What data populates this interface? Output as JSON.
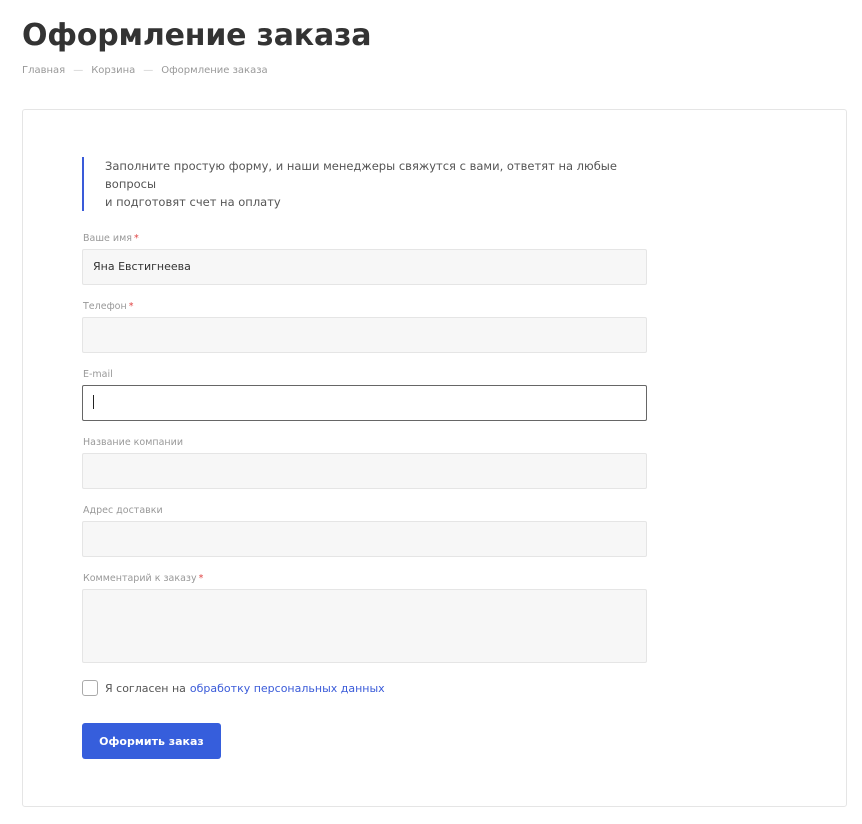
{
  "page": {
    "title": "Оформление заказа"
  },
  "breadcrumb": {
    "items": [
      "Главная",
      "Корзина",
      "Оформление заказа"
    ],
    "separator": "—"
  },
  "form": {
    "intro_line1": "Заполните простую форму, и наши менеджеры свяжутся с вами, ответят на любые вопросы",
    "intro_line2": "и подготовят счет на оплату",
    "required_mark": "*",
    "fields": [
      {
        "label": "Ваше имя",
        "required": true,
        "value": "Яна Евстигнеева"
      },
      {
        "label": "Телефон",
        "required": true,
        "value": ""
      },
      {
        "label": "E-mail",
        "required": false,
        "value": "",
        "focused": true
      },
      {
        "label": "Название компании",
        "required": false,
        "value": ""
      },
      {
        "label": "Адрес доставки",
        "required": false,
        "value": ""
      },
      {
        "label": "Комментарий к заказу",
        "required": true,
        "value": ""
      }
    ],
    "consent_text": "Я согласен на",
    "consent_link": "обработку персональных данных",
    "consent_checked": false,
    "submit_label": "Оформить заказ"
  },
  "colors": {
    "accent": "#365edc",
    "link": "#3a5bd9",
    "required": "#e04444"
  }
}
